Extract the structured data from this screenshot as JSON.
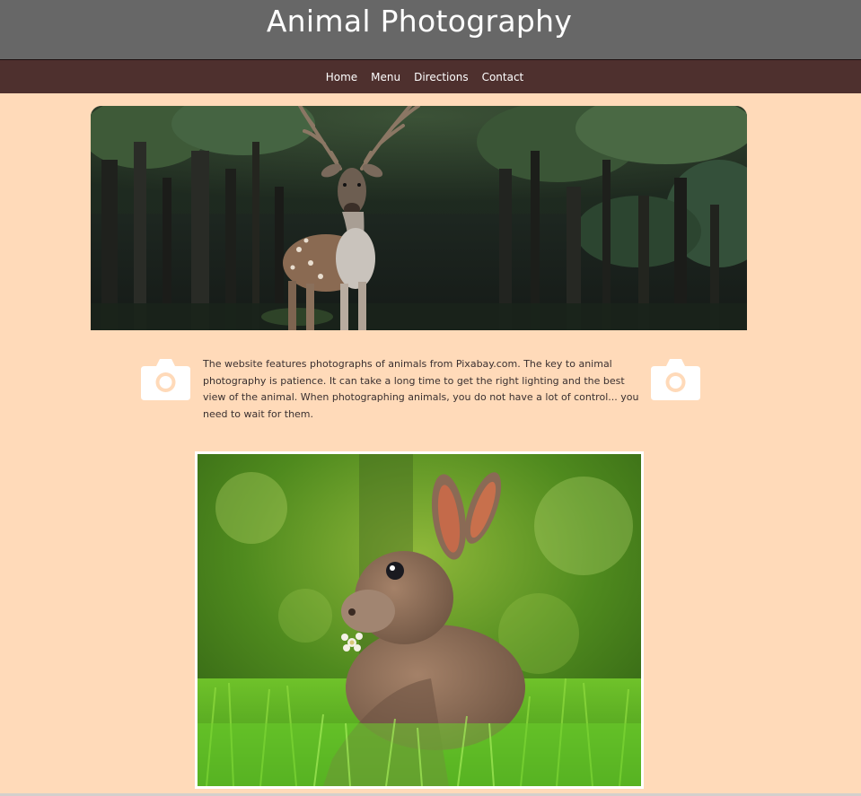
{
  "header": {
    "title": "Animal Photography"
  },
  "nav": {
    "items": [
      {
        "label": "Home"
      },
      {
        "label": "Menu"
      },
      {
        "label": "Directions"
      },
      {
        "label": "Contact"
      }
    ]
  },
  "hero": {
    "icon": "deer-photo"
  },
  "intro": {
    "text": "The website features photographs of animals from Pixabay.com. The key to animal photography is patience. It can take a long time to get the right lighting and the best view of the animal. When photographing animals, you do not have a lot of control... you need to wait for them.",
    "left_icon": "camera-icon",
    "right_icon": "camera-icon"
  },
  "gallery": {
    "icon": "rabbit-photo"
  },
  "colors": {
    "page_background": "#ffdab9",
    "header_background": "#676767",
    "nav_background": "#4e302e",
    "text": "#3a3030",
    "icon": "#ffffff"
  }
}
